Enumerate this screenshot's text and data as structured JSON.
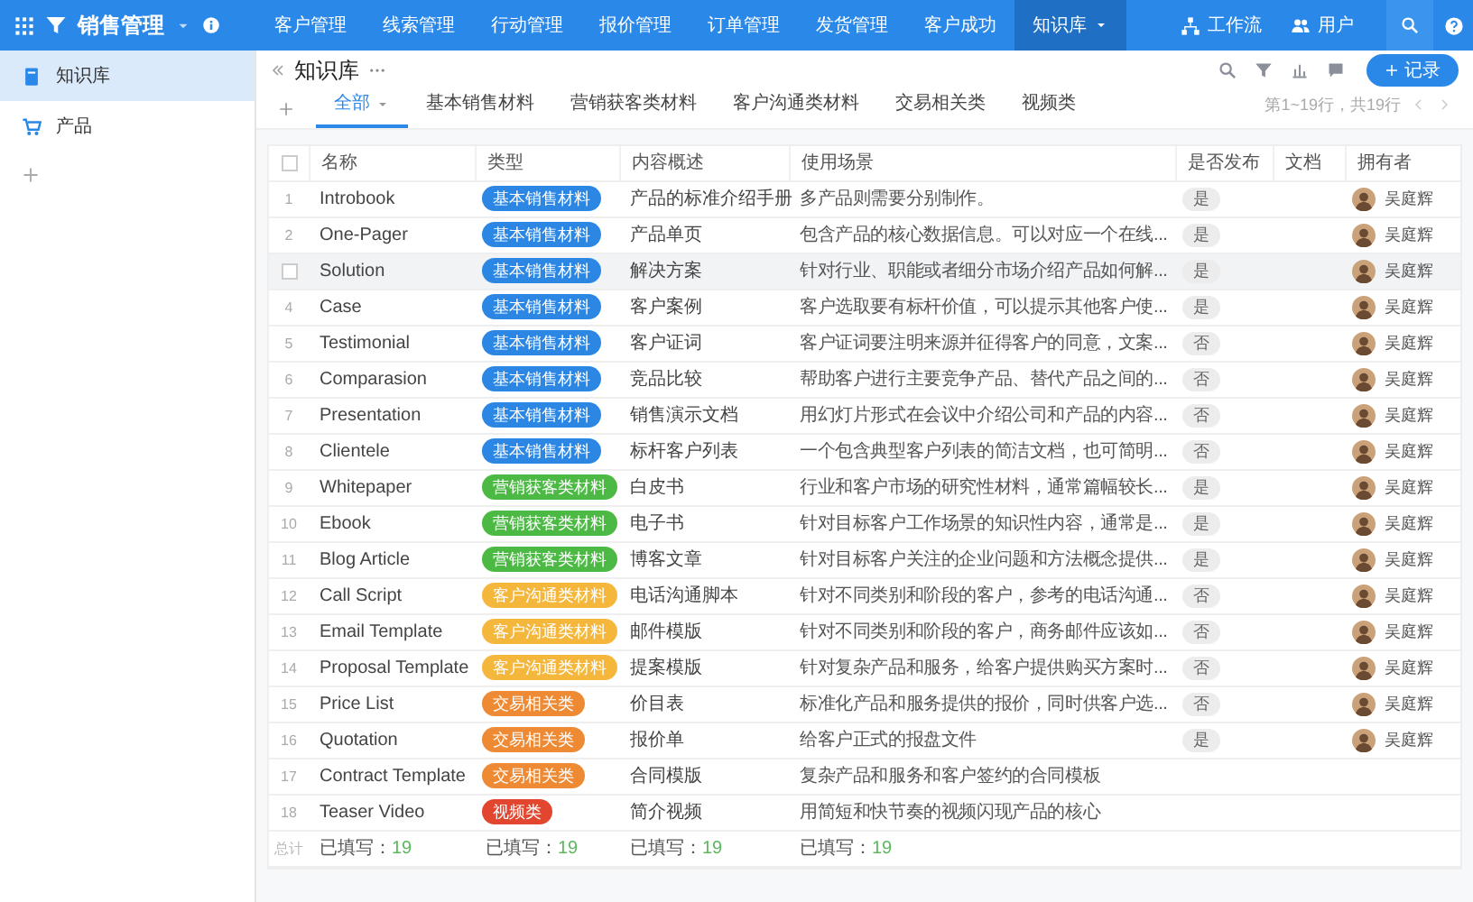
{
  "app": {
    "title": "销售管理"
  },
  "nav": [
    {
      "label": "客户管理",
      "selected": false
    },
    {
      "label": "线索管理",
      "selected": false
    },
    {
      "label": "行动管理",
      "selected": false
    },
    {
      "label": "报价管理",
      "selected": false
    },
    {
      "label": "订单管理",
      "selected": false
    },
    {
      "label": "发货管理",
      "selected": false
    },
    {
      "label": "客户成功",
      "selected": false
    },
    {
      "label": "知识库",
      "selected": true
    }
  ],
  "nav_right": [
    {
      "label": "工作流",
      "kind": "workflow"
    },
    {
      "label": "用户",
      "kind": "users"
    }
  ],
  "sidebar": {
    "items": [
      {
        "label": "知识库",
        "selected": true,
        "kind": "book"
      },
      {
        "label": "产品",
        "selected": false,
        "kind": "cart"
      }
    ]
  },
  "page": {
    "title": "知识库",
    "add_button": "记录"
  },
  "tabs": [
    {
      "label": "全部",
      "selected": true
    },
    {
      "label": "基本销售材料",
      "selected": false
    },
    {
      "label": "营销获客类材料",
      "selected": false
    },
    {
      "label": "客户沟通类材料",
      "selected": false
    },
    {
      "label": "交易相关类",
      "selected": false
    },
    {
      "label": "视频类",
      "selected": false
    }
  ],
  "pagination": "第1~19行，共19行",
  "table": {
    "select_all": {
      "checked": false
    },
    "columns": [
      "名称",
      "类型",
      "内容概述",
      "使用场景",
      "是否发布",
      "文档",
      "拥有者"
    ],
    "rows": [
      {
        "number": "1",
        "hovered": false,
        "name": "Introbook",
        "type": {
          "label": "基本销售材料",
          "color": "#2b87e3"
        },
        "summary": "产品的标准介绍手册",
        "usage": "多产品则需要分别制作。",
        "published": "是",
        "owner": "吴庭辉"
      },
      {
        "number": "2",
        "hovered": false,
        "name": "One-Pager",
        "type": {
          "label": "基本销售材料",
          "color": "#2b87e3"
        },
        "summary": "产品单页",
        "usage": "包含产品的核心数据信息。可以对应一个在线...",
        "published": "是",
        "owner": "吴庭辉"
      },
      {
        "hovered": true,
        "checked": false,
        "name": "Solution",
        "type": {
          "label": "基本销售材料",
          "color": "#2b87e3"
        },
        "summary": "解决方案",
        "usage": "针对行业、职能或者细分市场介绍产品如何解...",
        "published": "是",
        "owner": "吴庭辉"
      },
      {
        "number": "4",
        "hovered": false,
        "name": "Case",
        "type": {
          "label": "基本销售材料",
          "color": "#2b87e3"
        },
        "summary": "客户案例",
        "usage": "客户选取要有标杆价值，可以提示其他客户使...",
        "published": "是",
        "owner": "吴庭辉"
      },
      {
        "number": "5",
        "hovered": false,
        "name": "Testimonial",
        "type": {
          "label": "基本销售材料",
          "color": "#2b87e3"
        },
        "summary": "客户证词",
        "usage": "客户证词要注明来源并征得客户的同意，文案...",
        "published": "否",
        "owner": "吴庭辉"
      },
      {
        "number": "6",
        "hovered": false,
        "name": "Comparasion",
        "type": {
          "label": "基本销售材料",
          "color": "#2b87e3"
        },
        "summary": "竞品比较",
        "usage": "帮助客户进行主要竞争产品、替代产品之间的...",
        "published": "否",
        "owner": "吴庭辉"
      },
      {
        "number": "7",
        "hovered": false,
        "name": "Presentation",
        "type": {
          "label": "基本销售材料",
          "color": "#2b87e3"
        },
        "summary": "销售演示文档",
        "usage": "用幻灯片形式在会议中介绍公司和产品的内容...",
        "published": "否",
        "owner": "吴庭辉"
      },
      {
        "number": "8",
        "hovered": false,
        "name": "Clientele",
        "type": {
          "label": "基本销售材料",
          "color": "#2b87e3"
        },
        "summary": "标杆客户列表",
        "usage": "一个包含典型客户列表的简洁文档，也可简明...",
        "published": "否",
        "owner": "吴庭辉"
      },
      {
        "number": "9",
        "hovered": false,
        "name": "Whitepaper",
        "type": {
          "label": "营销获客类材料",
          "color": "#4cb944"
        },
        "summary": "白皮书",
        "usage": "行业和客户市场的研究性材料，通常篇幅较长...",
        "published": "是",
        "owner": "吴庭辉"
      },
      {
        "number": "10",
        "hovered": false,
        "name": "Ebook",
        "type": {
          "label": "营销获客类材料",
          "color": "#4cb944"
        },
        "summary": "电子书",
        "usage": "针对目标客户工作场景的知识性内容，通常是...",
        "published": "是",
        "owner": "吴庭辉"
      },
      {
        "number": "11",
        "hovered": false,
        "name": "Blog Article",
        "type": {
          "label": "营销获客类材料",
          "color": "#4cb944"
        },
        "summary": "博客文章",
        "usage": "针对目标客户关注的企业问题和方法概念提供...",
        "published": "是",
        "owner": "吴庭辉"
      },
      {
        "number": "12",
        "hovered": false,
        "name": "Call Script",
        "type": {
          "label": "客户沟通类材料",
          "color": "#f5b73b"
        },
        "summary": "电话沟通脚本",
        "usage": "针对不同类别和阶段的客户，参考的电话沟通...",
        "published": "否",
        "owner": "吴庭辉"
      },
      {
        "number": "13",
        "hovered": false,
        "name": "Email Template",
        "type": {
          "label": "客户沟通类材料",
          "color": "#f5b73b"
        },
        "summary": "邮件模版",
        "usage": "针对不同类别和阶段的客户，商务邮件应该如...",
        "published": "否",
        "owner": "吴庭辉"
      },
      {
        "number": "14",
        "hovered": false,
        "name": "Proposal Template",
        "type": {
          "label": "客户沟通类材料",
          "color": "#f5b73b"
        },
        "summary": "提案模版",
        "usage": "针对复杂产品和服务，给客户提供购买方案时...",
        "published": "否",
        "owner": "吴庭辉"
      },
      {
        "number": "15",
        "hovered": false,
        "name": "Price List",
        "type": {
          "label": "交易相关类",
          "color": "#ee8a33"
        },
        "summary": "价目表",
        "usage": "标准化产品和服务提供的报价，同时供客户选...",
        "published": "否",
        "owner": "吴庭辉"
      },
      {
        "number": "16",
        "hovered": false,
        "name": "Quotation",
        "type": {
          "label": "交易相关类",
          "color": "#ee8a33"
        },
        "summary": "报价单",
        "usage": "给客户正式的报盘文件",
        "published": "是",
        "owner": "吴庭辉"
      },
      {
        "number": "17",
        "hovered": false,
        "name": "Contract Template",
        "type": {
          "label": "交易相关类",
          "color": "#ee8a33"
        },
        "summary": "合同模版",
        "usage": "复杂产品和服务和客户签约的合同模板"
      },
      {
        "number": "18",
        "hovered": false,
        "name": "Teaser Video",
        "type": {
          "label": "视频类",
          "color": "#e2462f"
        },
        "summary": "简介视频",
        "usage": "用简短和快节奏的视频闪现产品的核心"
      }
    ],
    "footer": {
      "label": "总计",
      "cells": [
        {
          "label": "已填写：",
          "count": "19"
        },
        {
          "label": "已填写：",
          "count": "19"
        },
        {
          "label": "已填写：",
          "count": "19"
        },
        {
          "label": "已填写：",
          "count": "19"
        }
      ]
    }
  }
}
